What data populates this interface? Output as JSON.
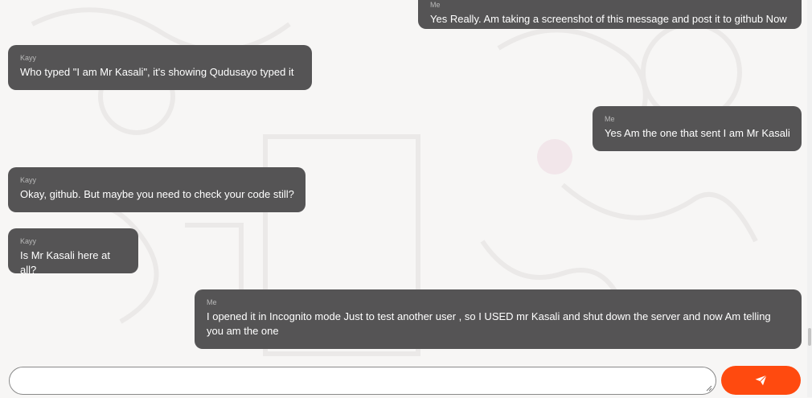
{
  "messages": [
    {
      "sender": "Me",
      "text": "Yes Really. Am taking a screenshot of this message and post it to github Now",
      "side": "right"
    },
    {
      "sender": "Kayy",
      "text": "Who typed \"I am Mr Kasali\", it's showing Qudusayo typed it",
      "side": "left"
    },
    {
      "sender": "Me",
      "text": "Yes Am the one that sent I am Mr Kasali",
      "side": "right"
    },
    {
      "sender": "Kayy",
      "text": "Okay, github. But maybe you need to check your code still?",
      "side": "left"
    },
    {
      "sender": "Kayy",
      "text": "Is Mr Kasali here at all?",
      "side": "left"
    },
    {
      "sender": "Me",
      "text": "I opened it in Incognito mode Just to test another user , so I USED mr Kasali and shut down the server and now Am telling you am the one",
      "side": "right"
    }
  ],
  "composer": {
    "value": "",
    "placeholder": "",
    "send_icon": "send-icon"
  },
  "colors": {
    "bubble": "#555455",
    "accent": "#ff4a0f",
    "background": "#f7f6f5"
  }
}
